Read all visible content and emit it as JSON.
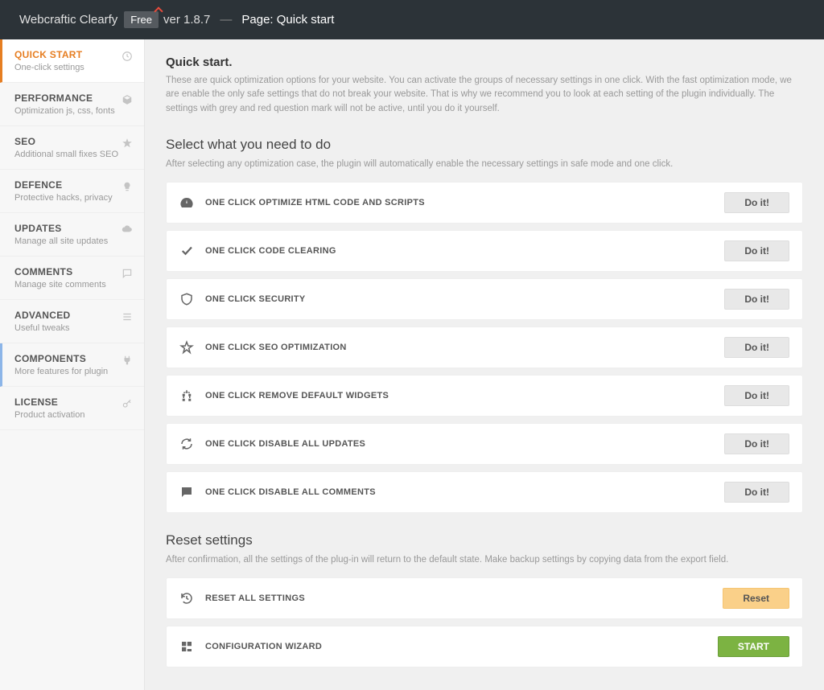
{
  "header": {
    "brand": "Webcraftic Clearfy",
    "badge": "Free",
    "version": "ver 1.8.7",
    "dash": "—",
    "page_prefix": "Page: ",
    "page_name": "Quick start"
  },
  "sidebar": [
    {
      "title": "QUICK START",
      "sub": "One-click settings",
      "icon": "clock",
      "active": true
    },
    {
      "title": "PERFORMANCE",
      "sub": "Optimization js, css, fonts",
      "icon": "cube"
    },
    {
      "title": "SEO",
      "sub": "Additional small fixes SEO",
      "icon": "star"
    },
    {
      "title": "DEFENCE",
      "sub": "Protective hacks, privacy",
      "icon": "bulb"
    },
    {
      "title": "UPDATES",
      "sub": "Manage all site updates",
      "icon": "cloud"
    },
    {
      "title": "COMMENTS",
      "sub": "Manage site comments",
      "icon": "comment"
    },
    {
      "title": "ADVANCED",
      "sub": "Useful tweaks",
      "icon": "bars"
    },
    {
      "title": "COMPONENTS",
      "sub": "More features for plugin",
      "icon": "plug",
      "components": true
    },
    {
      "title": "LICENSE",
      "sub": "Product activation",
      "icon": "key"
    }
  ],
  "main": {
    "title": "Quick start.",
    "desc": "These are quick optimization options for your website. You can activate the groups of necessary settings in one click. With the fast optimization mode, we are enable the only safe settings that do not break your website. That is why we recommend you to look at each setting of the plugin individually. The settings with grey and red question mark will not be active, until you do it yourself."
  },
  "select": {
    "title": "Select what you need to do",
    "desc": "After selecting any optimization case, the plugin will automatically enable the necessary settings in safe mode and one click.",
    "do_it": "Do it!",
    "options": [
      {
        "label": "ONE CLICK OPTIMIZE HTML CODE AND SCRIPTS",
        "icon": "gauge"
      },
      {
        "label": "ONE CLICK CODE CLEARING",
        "icon": "check"
      },
      {
        "label": "ONE CLICK SECURITY",
        "icon": "shield"
      },
      {
        "label": "ONE CLICK SEO OPTIMIZATION",
        "icon": "staro"
      },
      {
        "label": "ONE CLICK REMOVE DEFAULT WIDGETS",
        "icon": "tree"
      },
      {
        "label": "ONE CLICK DISABLE ALL UPDATES",
        "icon": "refresh"
      },
      {
        "label": "ONE CLICK DISABLE ALL COMMENTS",
        "icon": "chat"
      }
    ]
  },
  "reset": {
    "title": "Reset settings",
    "desc": "After confirmation, all the settings of the plug-in will return to the default state. Make backup settings by copying data from the export field.",
    "reset_label": "Reset",
    "start_label": "START",
    "rows": [
      {
        "label": "RESET ALL SETTINGS",
        "icon": "history",
        "btn": "reset"
      },
      {
        "label": "CONFIGURATION WIZARD",
        "icon": "grid",
        "btn": "start"
      }
    ]
  }
}
